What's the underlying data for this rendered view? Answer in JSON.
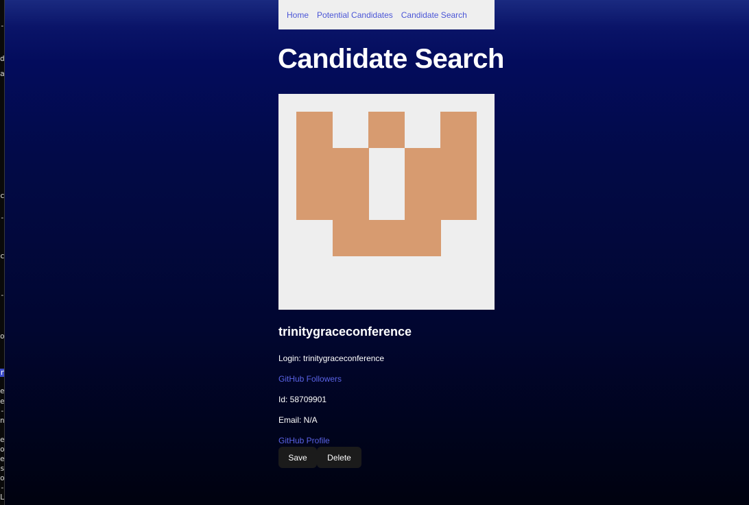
{
  "nav": {
    "items": [
      {
        "label": "Home"
      },
      {
        "label": "Potential Candidates"
      },
      {
        "label": "Candidate Search"
      }
    ]
  },
  "page": {
    "title": "Candidate Search"
  },
  "candidate": {
    "avatar_bg": "#eeeeee",
    "avatar_fg": "#d79b70",
    "name": "trinitygraceconference",
    "login_label": "Login: trinitygraceconference",
    "followers_link": "GitHub Followers",
    "id_label": "Id: 58709901",
    "email_label": "Email: N/A",
    "profile_link": "GitHub Profile"
  },
  "actions": {
    "save_label": "Save",
    "delete_label": "Delete"
  },
  "colors": {
    "link": "#4a55d6",
    "button_bg": "#1b1b1b",
    "background_top": "#0a1468",
    "background_bottom": "#00020f"
  }
}
